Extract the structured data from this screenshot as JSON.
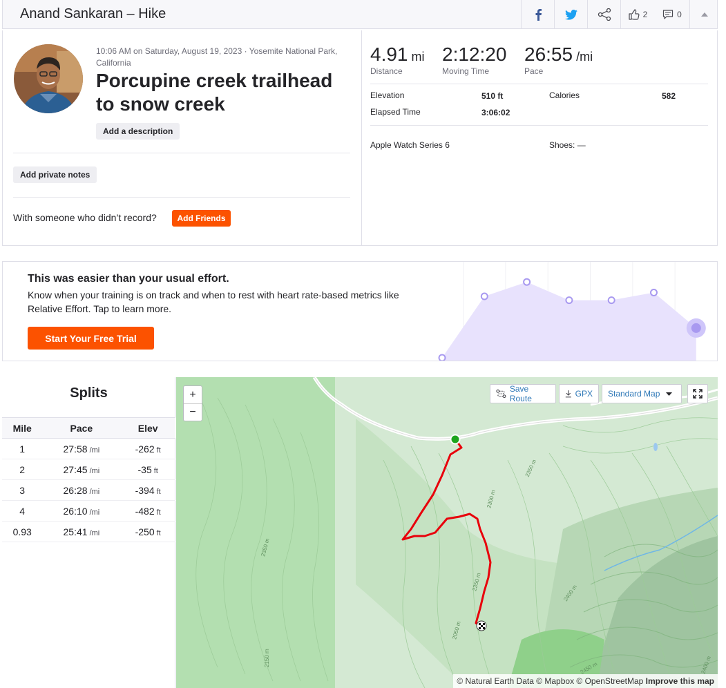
{
  "header": {
    "title": "Anand Sankaran – Hike",
    "kudos_count": "2",
    "comment_count": "0"
  },
  "activity": {
    "meta": "10:06 AM on Saturday, August 19, 2023 · Yosemite National Park, California",
    "title": "Porcupine creek trailhead to snow creek",
    "add_description": "Add a description",
    "add_private_notes": "Add private notes",
    "with_someone_text": "With someone who didn’t record?",
    "add_friends": "Add Friends"
  },
  "stats": {
    "distance": {
      "value": "4.91",
      "unit": "mi",
      "label": "Distance"
    },
    "moving_time": {
      "value": "2:12:20",
      "label": "Moving Time"
    },
    "pace": {
      "value": "26:55",
      "unit": "/mi",
      "label": "Pace"
    },
    "elevation": {
      "label": "Elevation",
      "value": "510 ft"
    },
    "calories": {
      "label": "Calories",
      "value": "582"
    },
    "elapsed_time": {
      "label": "Elapsed Time",
      "value": "3:06:02"
    },
    "device": "Apple Watch Series 6",
    "shoes": {
      "label": "Shoes:",
      "value": "—"
    }
  },
  "effort": {
    "title": "This was easier than your usual effort.",
    "body": "Know when your training is on track and when to rest with heart rate-based metrics like Relative Effort. Tap to learn more.",
    "cta": "Start Your Free Trial",
    "chart_data": {
      "type": "area",
      "values": [
        0,
        64,
        79,
        60,
        60,
        68,
        31
      ],
      "ylim": [
        0,
        100
      ],
      "highlight_last": true,
      "fill_color": "#e8e2fd",
      "point_color": "#a899f0"
    }
  },
  "splits": {
    "title": "Splits",
    "columns": [
      "Mile",
      "Pace",
      "Elev"
    ],
    "pace_unit": "/mi",
    "elev_unit": "ft",
    "rows": [
      {
        "mile": "1",
        "pace": "27:58",
        "elev": "-262"
      },
      {
        "mile": "2",
        "pace": "27:45",
        "elev": "-35"
      },
      {
        "mile": "3",
        "pace": "26:28",
        "elev": "-394"
      },
      {
        "mile": "4",
        "pace": "26:10",
        "elev": "-482"
      },
      {
        "mile": "0.93",
        "pace": "25:41",
        "elev": "-250"
      }
    ]
  },
  "map": {
    "save_route": "Save Route",
    "gpx": "GPX",
    "map_type": "Standard Map",
    "attribution": "© Natural Earth Data © Mapbox © OpenStreetMap",
    "improve": "Improve this map",
    "contour_labels": [
      "2350 m",
      "2300 m",
      "2350 m",
      "2350 m",
      "2400 m",
      "2050 m",
      "2150 m",
      "2450 m",
      "2400 m"
    ],
    "route_color": "#e8000b",
    "start_color": "#1ea51e"
  },
  "colors": {
    "accent": "#fc5200",
    "link": "#2e78b7",
    "facebook": "#3b5998",
    "twitter": "#1da1f2"
  }
}
